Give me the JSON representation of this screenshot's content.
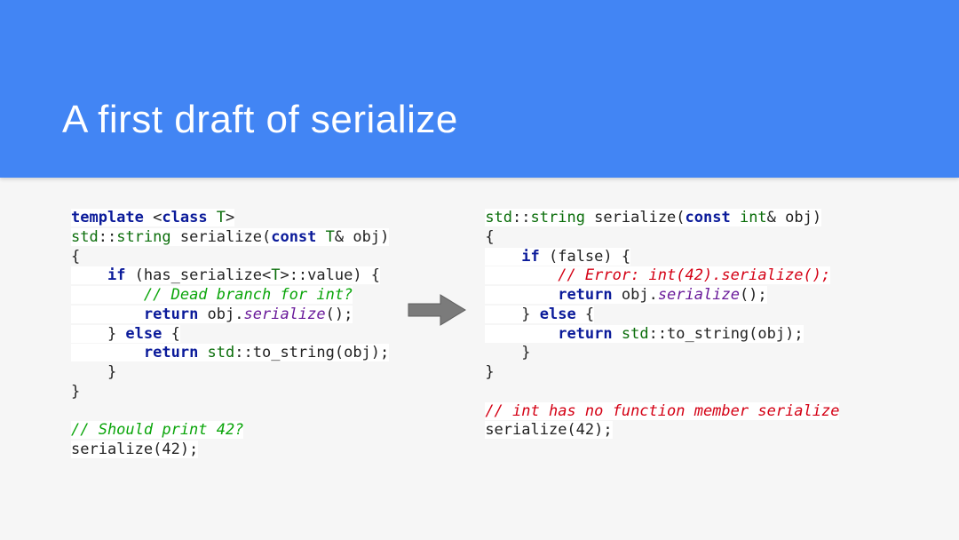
{
  "title": "A first draft of serialize",
  "left": {
    "l1a": "template ",
    "l1b": "<",
    "l1c": "class ",
    "l1d": "T",
    "l1e": ">",
    "l2a": "std",
    "l2b": "::",
    "l2c": "string",
    "l2d": " serialize(",
    "l2e": "const ",
    "l2f": "T",
    "l2g": "& obj)",
    "l3": "{",
    "l4a": "    ",
    "l4b": "if ",
    "l4c": "(has_serialize<",
    "l4d": "T",
    "l4e": ">::value) {",
    "l5a": "        ",
    "l5b": "// Dead branch for int?",
    "l6a": "        ",
    "l6b": "return ",
    "l6c": "obj.",
    "l6d": "serialize",
    "l6e": "();",
    "l7a": "    } ",
    "l7b": "else ",
    "l7c": "{",
    "l8a": "        ",
    "l8b": "return ",
    "l8c": "std",
    "l8d": "::to_string(obj);",
    "l9": "    }",
    "l10": "}",
    "l11": "",
    "l12": "// Should print 42?",
    "l13": "serialize(42);"
  },
  "right": {
    "l2a": "std",
    "l2b": "::",
    "l2c": "string",
    "l2d": " serialize(",
    "l2e": "const ",
    "l2f": "int",
    "l2g": "& obj)",
    "l3": "{",
    "l4a": "    ",
    "l4b": "if ",
    "l4c": "(false) {",
    "l5a": "        ",
    "l5b": "// Error: int(42).serialize();",
    "l6a": "        ",
    "l6b": "return ",
    "l6c": "obj.",
    "l6d": "serialize",
    "l6e": "();",
    "l7a": "    } ",
    "l7b": "else ",
    "l7c": "{",
    "l8a": "        ",
    "l8b": "return ",
    "l8c": "std",
    "l8d": "::to_string(obj);",
    "l9": "    }",
    "l10": "}",
    "l11": "",
    "l12": "// int has no function member serialize",
    "l13": "serialize(42);"
  }
}
